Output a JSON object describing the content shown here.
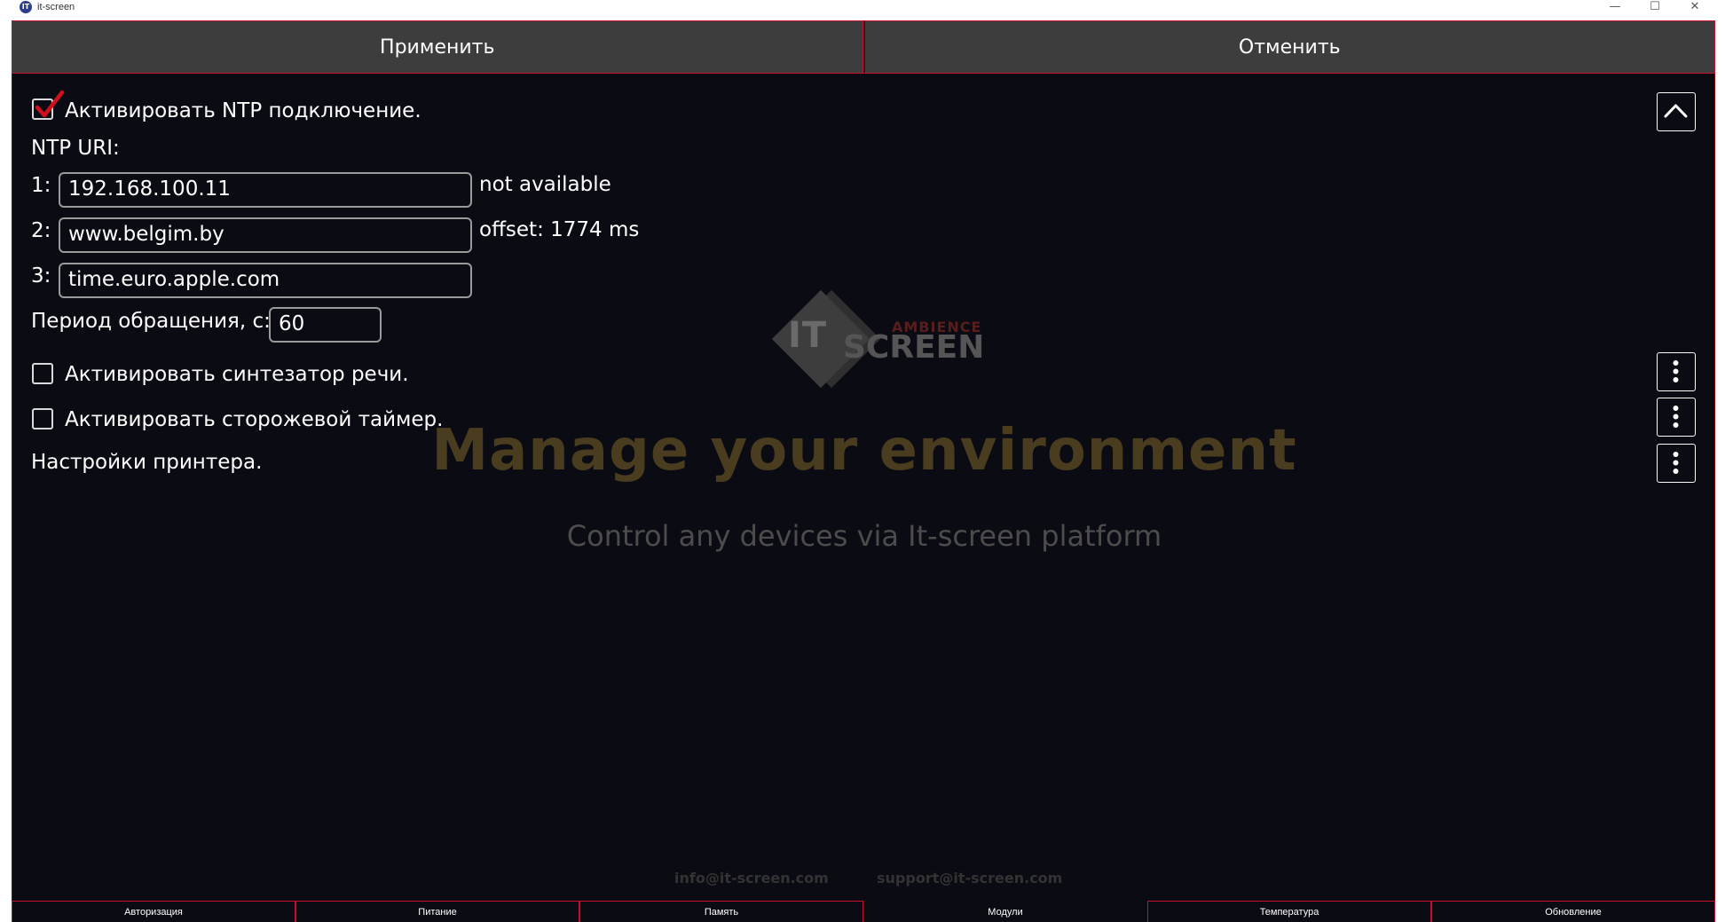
{
  "window": {
    "title": "it-screen",
    "icon_text": "IT",
    "controls": {
      "minimize": "—",
      "maximize": "☐",
      "close": "✕"
    }
  },
  "toolbar": {
    "apply_label": "Применить",
    "cancel_label": "Отменить"
  },
  "watermark": {
    "logo_it": "IT",
    "logo_ambience": "AMBIENCE",
    "logo_screen": "SCREEN",
    "headline": "Manage your environment",
    "subtitle": "Control any devices via It-screen platform",
    "email_info": "info@it-screen.com",
    "email_support": "support@it-screen.com"
  },
  "settings": {
    "ntp": {
      "enabled_label": "Активировать NTP подключение.",
      "enabled": true,
      "uri_label": "NTP URI:",
      "servers": [
        {
          "index": "1:",
          "value": "192.168.100.11",
          "status": "not available"
        },
        {
          "index": "2:",
          "value": "www.belgim.by",
          "status": "offset: 1774 ms"
        },
        {
          "index": "3:",
          "value": "time.euro.apple.com",
          "status": ""
        }
      ],
      "period_label": "Период обращения, с:",
      "period_value": "60"
    },
    "speech": {
      "label": "Активировать синтезатор речи.",
      "enabled": false
    },
    "watchdog": {
      "label": "Активировать сторожевой таймер.",
      "enabled": false
    },
    "printer": {
      "label": "Настройки принтера."
    }
  },
  "icons": {
    "collapse": "chevron-up-icon",
    "more": "more-vertical-icon"
  },
  "tabs": [
    {
      "label": "Авторизация",
      "active": false
    },
    {
      "label": "Питание",
      "active": false
    },
    {
      "label": "Память",
      "active": false
    },
    {
      "label": "Модули",
      "active": true
    },
    {
      "label": "Температура",
      "active": false
    },
    {
      "label": "Обновление",
      "active": false
    }
  ],
  "colors": {
    "accent": "#c8102e",
    "background": "#0b0c13",
    "button": "#3d3d3d"
  }
}
